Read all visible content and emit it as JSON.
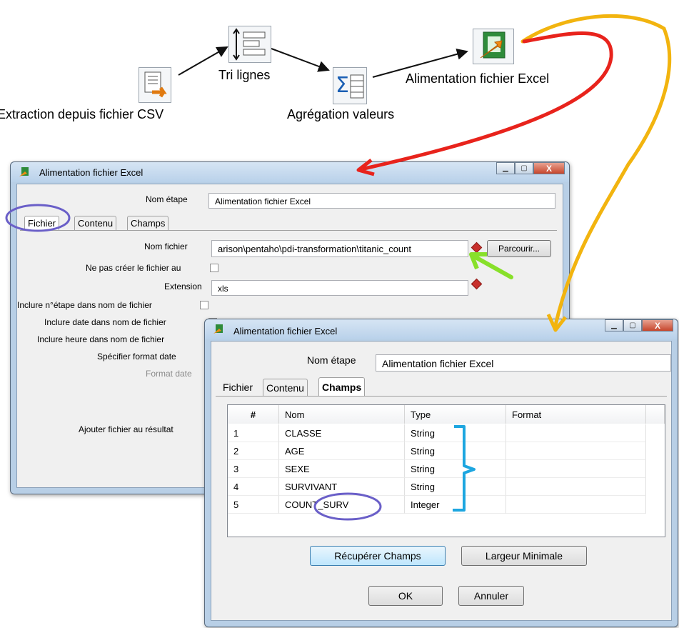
{
  "workflow": {
    "steps": [
      {
        "label": "Extraction depuis fichier CSV",
        "icon": "csv-input-icon"
      },
      {
        "label": "Tri lignes",
        "icon": "sort-rows-icon"
      },
      {
        "label": "Agrégation valeurs",
        "icon": "aggregate-icon"
      },
      {
        "label": "Alimentation fichier Excel",
        "icon": "excel-output-icon"
      }
    ]
  },
  "dialog1": {
    "title": "Alimentation fichier Excel",
    "nom_etape_label": "Nom étape",
    "nom_etape_value": "Alimentation fichier Excel",
    "tabs": [
      "Fichier",
      "Contenu",
      "Champs"
    ],
    "nom_fichier_label": "Nom fichier",
    "nom_fichier_value": "arison\\pentaho\\pdi-transformation\\titanic_count",
    "parcourir_label": "Parcourir...",
    "ne_pas_creer_label": "Ne pas créer le fichier au",
    "extension_label": "Extension",
    "extension_value": "xls",
    "inclure_etape_label": "Inclure n°étape dans nom de fichier",
    "inclure_date_label": "Inclure date dans nom de fichier",
    "inclure_heure_label": "Inclure heure dans nom de fichier",
    "specifier_format_label": "Spécifier format date",
    "format_date_label": "Format date",
    "ajouter_fichier_label": "Ajouter fichier au résultat"
  },
  "dialog2": {
    "title": "Alimentation fichier Excel",
    "nom_etape_label": "Nom étape",
    "nom_etape_value": "Alimentation fichier Excel",
    "tabs": [
      "Fichier",
      "Contenu",
      "Champs"
    ],
    "columns": [
      "#",
      "Nom",
      "Type",
      "Format"
    ],
    "rows": [
      {
        "num": "1",
        "nom": "CLASSE",
        "type": "String",
        "format": ""
      },
      {
        "num": "2",
        "nom": "AGE",
        "type": "String",
        "format": ""
      },
      {
        "num": "3",
        "nom": "SEXE",
        "type": "String",
        "format": ""
      },
      {
        "num": "4",
        "nom": "SURVIVANT",
        "type": "String",
        "format": ""
      },
      {
        "num": "5",
        "nom": "COUNT_SURV",
        "type": "Integer",
        "format": ""
      }
    ],
    "recuperer_label": "Récupérer Champs",
    "largeur_label": "Largeur Minimale",
    "ok_label": "OK",
    "annuler_label": "Annuler"
  },
  "annotation_colors": {
    "red_arrow": "#e8231c",
    "yellow_arrow": "#f2b40f",
    "green_arrow": "#88e02a",
    "purple_circle": "#6a5fc8",
    "blue_bracket": "#1da6e0"
  }
}
